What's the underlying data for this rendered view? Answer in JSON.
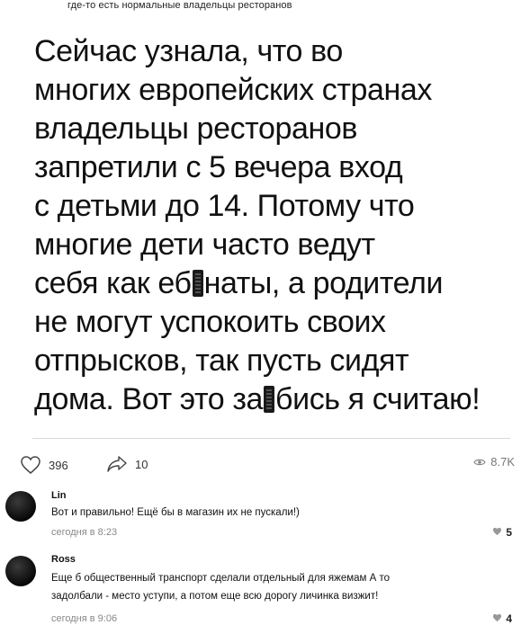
{
  "caption": "где-то есть нормальные владельцы ресторанов",
  "post": {
    "lines": [
      "Сейчас узнала, что во",
      "многих европейских странах",
      "владельцы ресторанов",
      "запретили с 5 вечера вход",
      "с детьми до 14. Потому что",
      "многие дети часто ведут"
    ],
    "line7_before": "себя как еб",
    "line7_after": "наты, а родители",
    "line8": "не могут успокоить своих",
    "line9": "отпрысков, так пусть сидят",
    "line10_before": "дома. Вот это за",
    "line10_after": "бись я считаю!"
  },
  "stats": {
    "likes": "396",
    "shares": "10",
    "views": "8.7K"
  },
  "comments": [
    {
      "name": "Lin",
      "text_lines": [
        "Вот и правильно! Ещё бы в магазин их не пускали!)"
      ],
      "time": "сегодня в 8:23",
      "likes": "5"
    },
    {
      "name": "Ross",
      "text_lines": [
        "Еще б общественный транспорт сделали отдельный для яжемам А то",
        "задолбали - место уступи, а потом еще всю дорогу личинка визжит!"
      ],
      "time": "сегодня в 9:06",
      "likes": "4"
    }
  ]
}
